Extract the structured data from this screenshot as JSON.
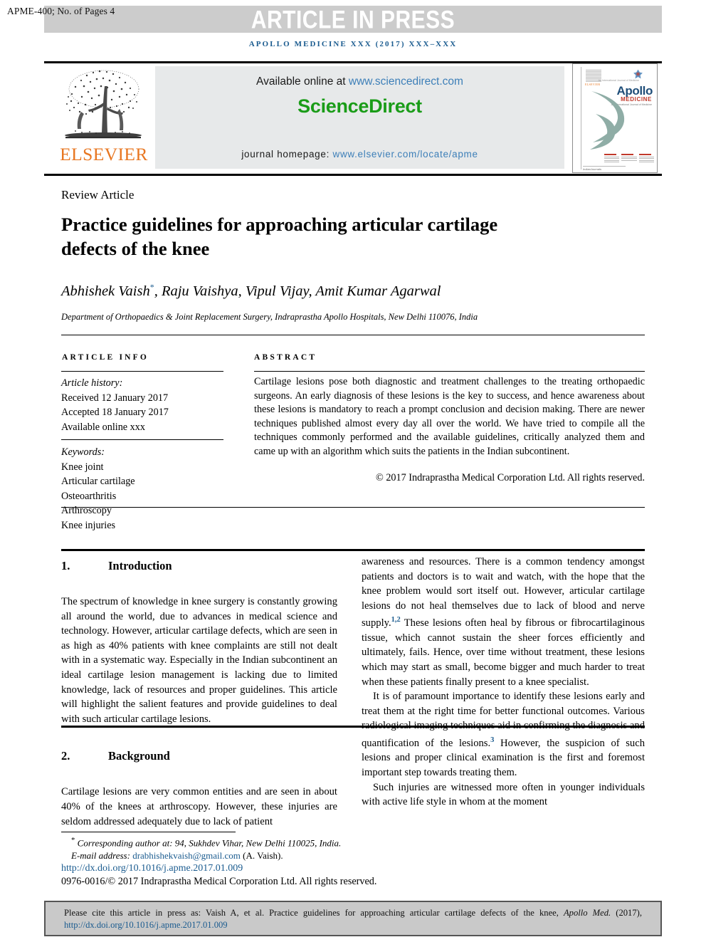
{
  "banner": {
    "page_info": "APME-400; No. of Pages 4",
    "article_in_press": "ARTICLE IN PRESS",
    "journal_line": "APOLLO MEDICINE XXX (2017) XXX–XXX"
  },
  "masthead": {
    "publisher": "ELSEVIER",
    "available_prefix": "Available online at ",
    "available_link": "www.sciencedirect.com",
    "sciencedirect_logo": "ScienceDirect",
    "homepage_prefix": "journal homepage: ",
    "homepage_link": "www.elsevier.com/locate/apme",
    "cover": {
      "brand": "Apollo",
      "brand_sub": "MEDICINE",
      "brand_tiny": "An International Journal of Medicine",
      "publisher_small": "ELSEVIER",
      "footer_note": "IndianJournals"
    }
  },
  "article": {
    "type_label": "Review Article",
    "title": "Practice guidelines for approaching articular cartilage defects of the knee",
    "authors": "Abhishek Vaish",
    "authors_rest": ", Raju Vaishya, Vipul Vijay, Amit Kumar Agarwal",
    "corresponding_marker": "*",
    "affiliation": "Department of Orthopaedics & Joint Replacement Surgery, Indraprastha Apollo Hospitals, New Delhi 110076, India"
  },
  "article_info": {
    "heading": "ARTICLE INFO",
    "history_label": "Article history:",
    "history": [
      "Received 12 January 2017",
      "Accepted 18 January 2017",
      "Available online xxx"
    ],
    "keywords_label": "Keywords:",
    "keywords": [
      "Knee joint",
      "Articular cartilage",
      "Osteoarthritis",
      "Arthroscopy",
      "Knee injuries"
    ]
  },
  "abstract": {
    "heading": "ABSTRACT",
    "text": "Cartilage lesions pose both diagnostic and treatment challenges to the treating orthopaedic surgeons. An early diagnosis of these lesions is the key to success, and hence awareness about these lesions is mandatory to reach a prompt conclusion and decision making. There are newer techniques published almost every day all over the world. We have tried to compile all the techniques commonly performed and the available guidelines, critically analyzed them and came up with an algorithm which suits the patients in the Indian subcontinent.",
    "copyright": "© 2017 Indraprastha Medical Corporation Ltd. All rights reserved."
  },
  "body": {
    "sections": [
      {
        "number": "1.",
        "title": "Introduction"
      },
      {
        "number": "2.",
        "title": "Background"
      }
    ],
    "intro_paragraph": "The spectrum of knowledge in knee surgery is constantly growing all around the world, due to advances in medical science and technology. However, articular cartilage defects, which are seen in as high as 40% patients with knee complaints are still not dealt with in a systematic way. Especially in the Indian subcontinent an ideal cartilage lesion management is lacking due to limited knowledge, lack of resources and proper guidelines. This article will highlight the salient features and provide guidelines to deal with such articular cartilage lesions.",
    "background_paragraph_part1": "Cartilage lesions are very common entities and are seen in about 40% of the knees at arthroscopy. However, these injuries are seldom addressed adequately due to lack of patient",
    "background_paragraph_part2_a": "awareness and resources. There is a common tendency amongst patients and doctors is to wait and watch, with the hope that the knee problem would sort itself out. However, articular cartilage lesions do not heal themselves due to lack of blood and nerve supply.",
    "background_ref1": "1,2",
    "background_paragraph_part2_b": " These lesions often heal by fibrous or fibrocartilaginous tissue, which cannot sustain the sheer forces efficiently and ultimately, fails. Hence, over time without treatment, these lesions which may start as small, become bigger and much harder to treat when these patients finally present to a knee specialist.",
    "paragraph_3_a": "It is of paramount importance to identify these lesions early and treat them at the right time for better functional outcomes. Various radiological imaging techniques aid in confirming the diagnosis and quantification of the lesions.",
    "paragraph_3_ref": "3",
    "paragraph_3_b": " However, the suspicion of such lesions and proper clinical examination is the first and foremost important step towards treating them.",
    "paragraph_4": "Such injuries are witnessed more often in younger individuals with active life style in whom at the moment"
  },
  "footnotes": {
    "corresponding": "Corresponding author at: 94, Sukhdev Vihar, New Delhi 110025, India.",
    "email_label": "E-mail address: ",
    "email": "drabhishekvaish@gmail.com",
    "email_owner": " (A. Vaish).",
    "doi": "http://dx.doi.org/10.1016/j.apme.2017.01.009",
    "issn_line": "0976-0016/© 2017 Indraprastha Medical Corporation Ltd. All rights reserved."
  },
  "cite_box": {
    "text_before": "Please cite this article in press as: Vaish A, et al. Practice guidelines for approaching articular cartilage defects of the knee, ",
    "journal_italic": "Apollo Med.",
    "year": " (2017), ",
    "link": "http://dx.doi.org/10.1016/j.apme.2017.01.009"
  },
  "colors": {
    "link_blue": "#1a5b8f",
    "sciencedirect_green": "#1a9c18",
    "elsevier_orange": "#e87722",
    "banner_gray": "#cccccc",
    "panel_gray": "#e7e9ea",
    "cite_gray": "#c9c9c9"
  }
}
